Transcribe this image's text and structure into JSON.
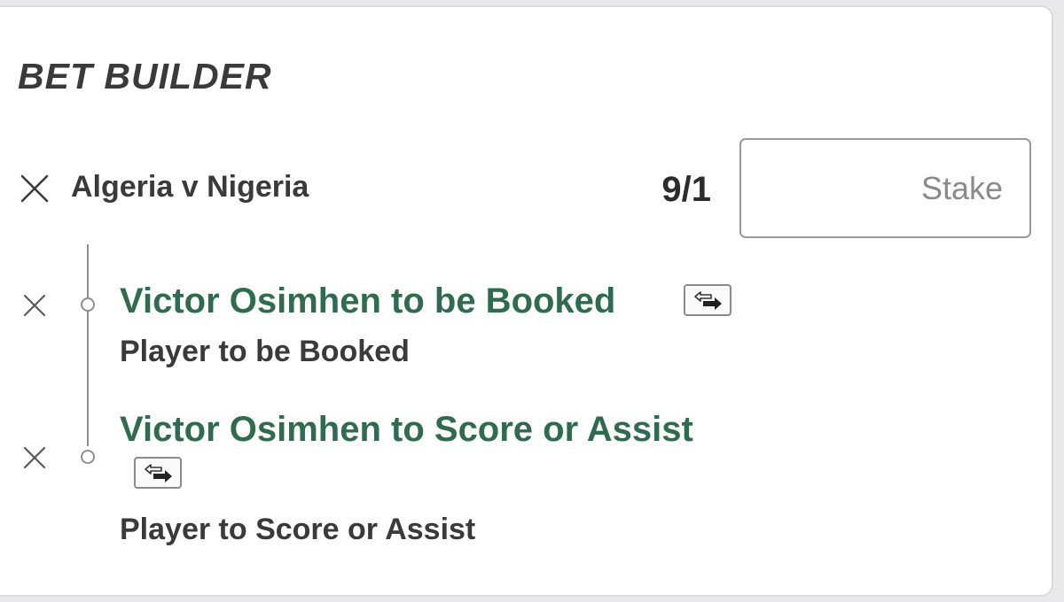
{
  "title": "BET BUILDER",
  "event": {
    "name": "Algeria v Nigeria",
    "odds": "9/1",
    "stake_placeholder": "Stake",
    "stake_value": ""
  },
  "selections": [
    {
      "name": "Victor Osimhen to be Booked",
      "market": "Player to be Booked",
      "swap_icon": "swap-arrows-icon",
      "remove_icon": "close-icon"
    },
    {
      "name": "Victor Osimhen to Score or Assist",
      "market": "Player to Score or Assist",
      "swap_icon": "swap-arrows-icon",
      "remove_icon": "close-icon"
    }
  ],
  "colors": {
    "selection_green": "#2e6b4f",
    "text_dark": "#3a3a3a",
    "timeline_gray": "#8f8f8f"
  }
}
